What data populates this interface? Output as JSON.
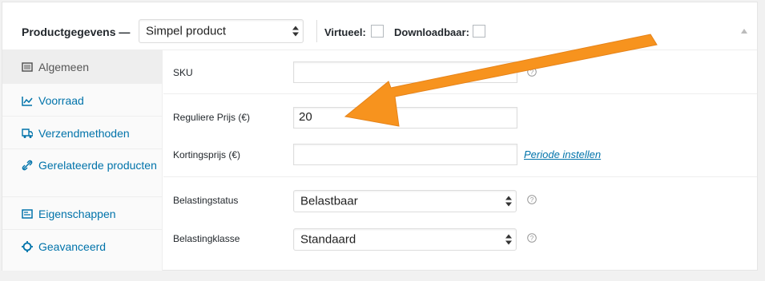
{
  "header": {
    "title": "Productgegevens —",
    "product_type": "Simpel product",
    "virtual_label": "Virtueel:",
    "downloadable_label": "Downloadbaar:"
  },
  "tabs": [
    {
      "label": "Algemeen",
      "icon": "list-icon",
      "active": true
    },
    {
      "label": "Voorraad",
      "icon": "inventory-chart-icon"
    },
    {
      "label": "Verzendmethoden",
      "icon": "truck-icon"
    },
    {
      "label": "Gerelateerde producten",
      "icon": "link-icon"
    },
    {
      "label": "Eigenschappen",
      "icon": "attributes-icon"
    },
    {
      "label": "Geavanceerd",
      "icon": "gear-icon"
    }
  ],
  "fields": {
    "sku": {
      "label": "SKU",
      "value": ""
    },
    "regular_price": {
      "label": "Reguliere Prijs (€)",
      "value": "20"
    },
    "sale_price": {
      "label": "Kortingsprijs (€)",
      "value": ""
    },
    "schedule_link": "Periode instellen",
    "tax_status": {
      "label": "Belastingstatus",
      "value": "Belastbaar"
    },
    "tax_class": {
      "label": "Belastingklasse",
      "value": "Standaard"
    }
  },
  "colors": {
    "arrow": "#f7931e",
    "link": "#0073aa"
  }
}
